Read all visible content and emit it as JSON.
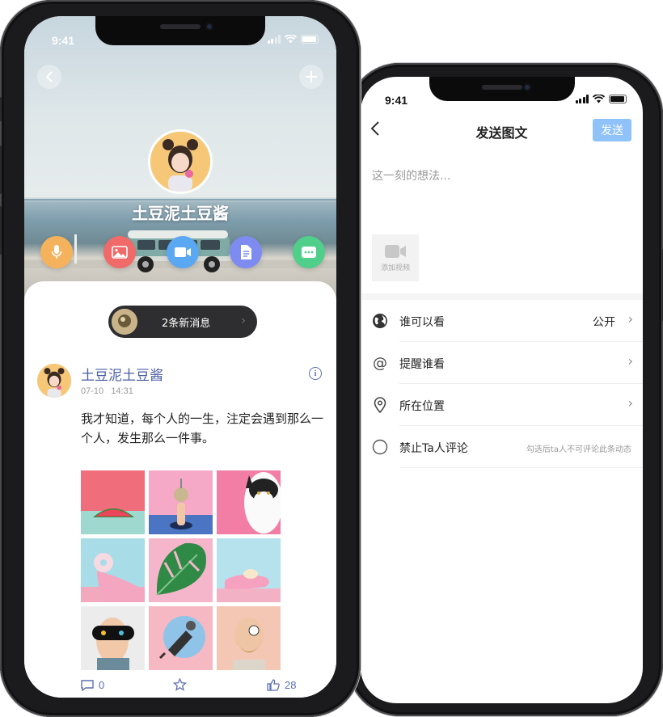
{
  "status_bar": {
    "time": "9:41"
  },
  "profile": {
    "name": "土豆泥土豆酱",
    "actions": [
      {
        "name": "voice",
        "icon": "microphone-icon",
        "color": "#f5b25c"
      },
      {
        "name": "image",
        "icon": "image-icon",
        "color": "#f06a6a"
      },
      {
        "name": "video",
        "icon": "video-icon",
        "color": "#5aa7f2"
      },
      {
        "name": "document",
        "icon": "document-icon",
        "color": "#7e8bf0"
      },
      {
        "name": "message",
        "icon": "chat-icon",
        "color": "#4fcf8a"
      }
    ],
    "new_messages": "2条新消息"
  },
  "post": {
    "author": "土豆泥土豆酱",
    "date": "07-10",
    "time": "14:31",
    "text": "我才知道，每个人的一生，注定会遇到那么一个人，发生那么一件事。",
    "images": [
      {
        "icon": "watermelon-photo"
      },
      {
        "icon": "hand-pin-photo"
      },
      {
        "icon": "cat-photo"
      },
      {
        "icon": "donut-photo"
      },
      {
        "icon": "monstera-leaf-photo"
      },
      {
        "icon": "glove-macaron-photo"
      },
      {
        "icon": "sleep-mask-photo"
      },
      {
        "icon": "tattoo-machine-photo"
      },
      {
        "icon": "bearded-man-photo"
      }
    ],
    "comments": "0",
    "likes": "28"
  },
  "compose": {
    "title": "发送图文",
    "send_label": "发送",
    "placeholder": "这一刻的想法...",
    "add_video_label": "添加视频",
    "settings": [
      {
        "label": "谁可以看",
        "value": "公开",
        "icon": "globe-icon"
      },
      {
        "label": "提醒谁看",
        "value": "",
        "icon": "at-icon"
      },
      {
        "label": "所在位置",
        "value": "",
        "icon": "location-pin-icon"
      },
      {
        "label": "禁止Ta人评论",
        "hint": "勾选后ta人不可评论此条动态",
        "icon": "radio-icon"
      }
    ]
  }
}
